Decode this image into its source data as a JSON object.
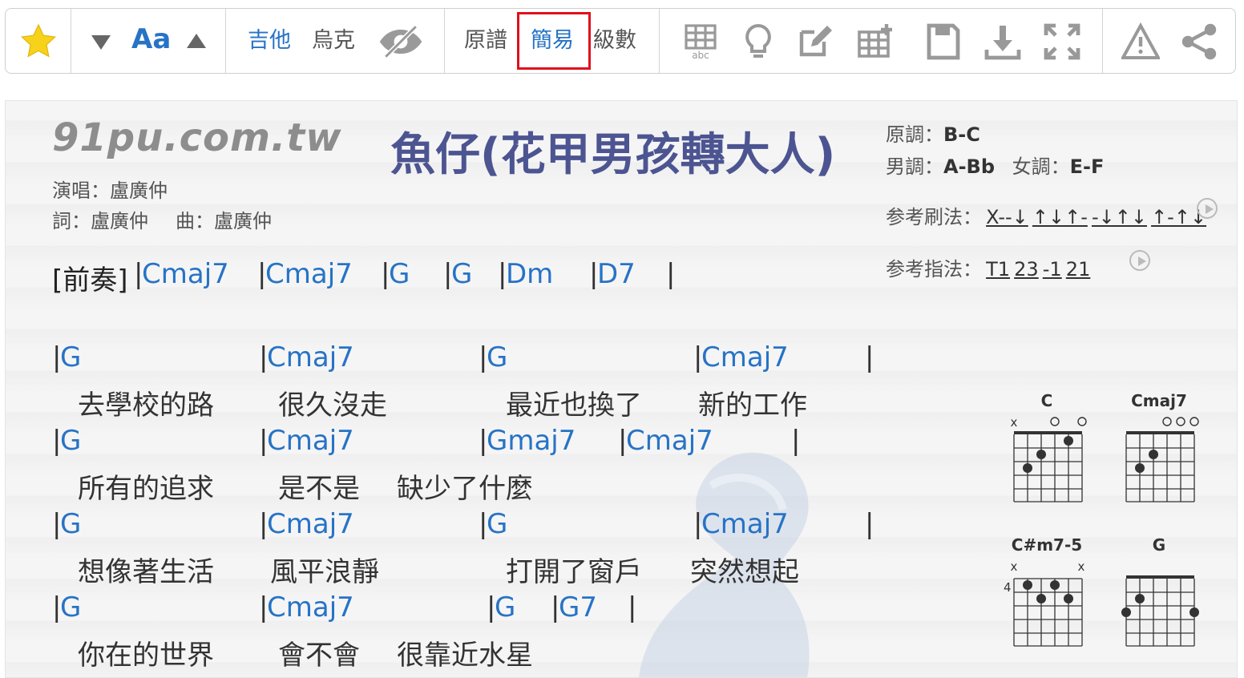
{
  "toolbar": {
    "favorite_icon": "star-icon",
    "font_label": "Aa",
    "instrument_guitar": "吉他",
    "instrument_ukulele": "烏克",
    "notation_original": "原譜",
    "notation_simple": "簡易",
    "notation_numeric": "級數",
    "accent_color": "#2773c6",
    "highlight_color": "#e0101b"
  },
  "song": {
    "site": "91pu.com.tw",
    "title": "魚仔(花甲男孩轉大人)",
    "singer": "演唱：盧廣仲",
    "lyricist": "詞：盧廣仲",
    "composer": "曲：盧廣仲",
    "original_key_label": "原調：",
    "original_key": "B-C",
    "male_key_label": "男調：",
    "male_key": "A-Bb",
    "female_key_label": "女調：",
    "female_key": "E-F",
    "strum_label": "参考刷法：",
    "strum_patterns": [
      "X--↓",
      "↑↓↑-",
      "-↓↑↓",
      "↑-↑↓"
    ],
    "picking_label": "参考指法：",
    "picking_patterns": [
      "T1",
      "23",
      "-1",
      "21"
    ]
  },
  "intro": {
    "label": "[前奏]",
    "chords": [
      "Cmaj7",
      "Cmaj7",
      "G",
      "G",
      "Dm",
      "D7"
    ]
  },
  "lines": [
    {
      "chords": [
        "G",
        "Cmaj7",
        "G",
        "Cmaj7"
      ],
      "lyrics": [
        "去學校的路",
        "很久沒走",
        "最近也換了",
        "新的工作"
      ]
    },
    {
      "chords": [
        "G",
        "Cmaj7",
        "Gmaj7",
        "Cmaj7"
      ],
      "lyrics": [
        "所有的追求",
        "是不是",
        "缺少了什麼"
      ]
    },
    {
      "chords": [
        "G",
        "Cmaj7",
        "G",
        "Cmaj7"
      ],
      "lyrics": [
        "想像著生活",
        "風平浪靜",
        "打開了窗戶",
        "突然想起"
      ]
    },
    {
      "chords": [
        "G",
        "Cmaj7",
        "G",
        "G7"
      ],
      "lyrics": [
        "你在的世界",
        "會不會",
        "很靠近水星"
      ]
    }
  ],
  "chord_diagrams": [
    {
      "name": "C",
      "markers": "x o o"
    },
    {
      "name": "Cmaj7",
      "markers": "ooo"
    },
    {
      "name": "C#m7-5",
      "markers": "x x",
      "fret": "4"
    },
    {
      "name": "G"
    }
  ]
}
